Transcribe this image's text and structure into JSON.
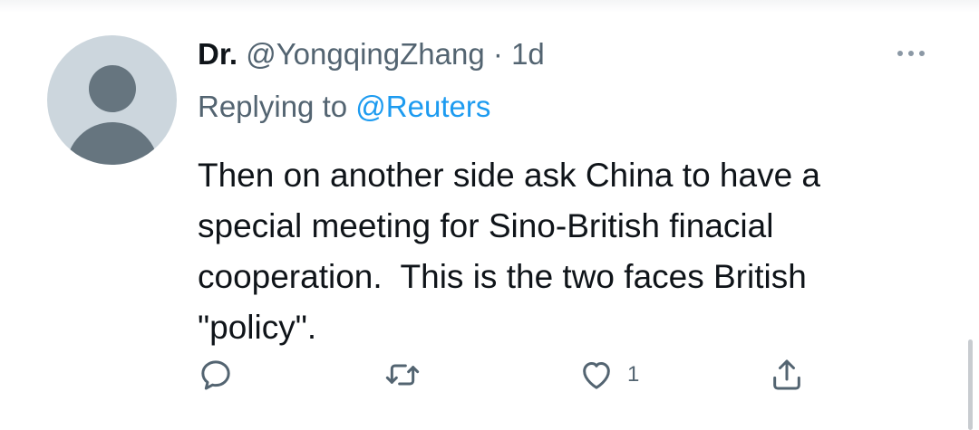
{
  "tweet": {
    "display_name": "Dr.",
    "handle": "@YongqingZhang",
    "separator": "·",
    "time": "1d",
    "reply_prefix": "Replying to",
    "reply_mention": "@Reuters",
    "text": "Then on another side ask China to have a\nspecial meeting for Sino-British finacial\ncooperation.  This is the two faces British\n\"policy\".",
    "like_count": "1"
  },
  "icons": {
    "avatar": "default-avatar",
    "more": "more-dots-icon",
    "reply": "reply-icon",
    "retweet": "retweet-icon",
    "like": "heart-icon",
    "share": "share-icon"
  },
  "colors": {
    "text": "#0f1419",
    "secondary": "#536471",
    "link": "#1d9bf0",
    "avatar_bg": "#ccd6dd",
    "avatar_fg": "#66757f"
  }
}
